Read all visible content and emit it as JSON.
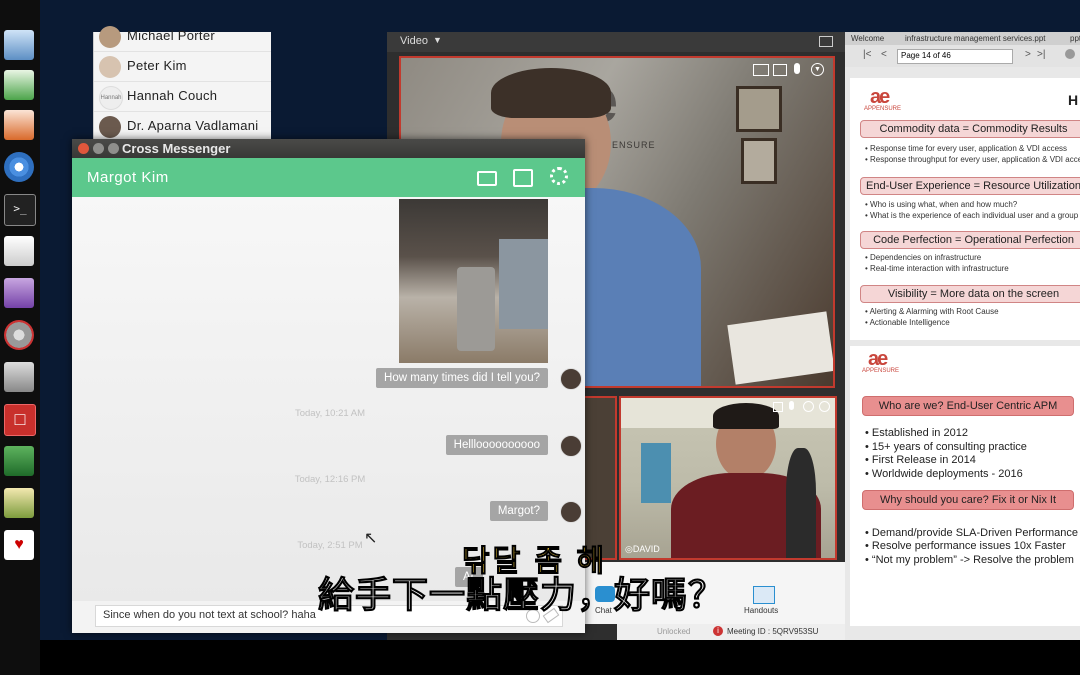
{
  "launcher": {
    "icons": [
      "image-viewer-icon",
      "spreadsheet-icon",
      "presentation-icon",
      "browser-icon",
      "terminal-icon",
      "text-editor-icon",
      "remote-desktop-icon",
      "settings-icon",
      "calculator-icon",
      "app-launcher-icon",
      "media-icon",
      "image-search-icon",
      "cards-game-icon"
    ]
  },
  "contacts": [
    {
      "name": "Michael Porter"
    },
    {
      "name": "Peter Kim"
    },
    {
      "name": "Hannah Couch",
      "avatar_text": "Hannah"
    },
    {
      "name": "Dr. Aparna Vadlamani"
    }
  ],
  "messenger": {
    "title": "Cross Messenger",
    "contact_name": "Margot Kim",
    "header_color": "#5cc88c",
    "messages": [
      {
        "text": "How many times did I tell you?"
      },
      {
        "timestamp": "Today, 10:21 AM"
      },
      {
        "text": "Hellloooooooooo"
      },
      {
        "timestamp": "Today, 12:16 PM"
      },
      {
        "text": "Margot?"
      },
      {
        "timestamp": "Today, 2:51 PM"
      },
      {
        "text": "Ar"
      }
    ],
    "composer_value": "Since when do you not text at school? haha"
  },
  "video": {
    "toolbar_label": "Video",
    "participant_name": "DAVID",
    "chat_label": "Chat",
    "handouts_label": "Handouts",
    "status": "Unlocked",
    "meeting_id": "Meeting ID : 5QRV953SU",
    "accent": "#c23a2e",
    "logo_text": "APPENSURE"
  },
  "slides": {
    "tabs": [
      "Welcome",
      "infrastructure management services.ppt",
      "ppt"
    ],
    "page_indicator": "Page 14 of 46",
    "slide1": {
      "logo": "APPENSURE",
      "heading": "H",
      "sections": [
        {
          "title": "Commodity data = Commodity Results",
          "bullets": [
            "Response time for every user, application & VDI access",
            "Response throughput for every user, application & VDI access"
          ]
        },
        {
          "title": "End-User Experience = Resource Utilization",
          "bullets": [
            "Who is using what, when and how much?",
            "What is the experience of each individual user and a group"
          ]
        },
        {
          "title": "Code Perfection = Operational Perfection",
          "bullets": [
            "Dependencies on infrastructure",
            "Real-time interaction with infrastructure"
          ]
        },
        {
          "title": "Visibility = More data on the screen",
          "bullets": [
            "Alerting & Alarming with Root Cause",
            "Actionable Intelligence"
          ]
        }
      ]
    },
    "slide2": {
      "logo": "APPENSURE",
      "sections": [
        {
          "title": "Who are we?  End-User Centric APM",
          "bullets": [
            "Established in 2012",
            "15+ years of consulting practice",
            "First Release in 2014",
            "Worldwide deployments - 2016"
          ]
        },
        {
          "title": "Why should you care? Fix it or Nix It",
          "bullets": [
            "Demand/provide SLA-Driven Performance",
            "Resolve performance issues 10x Faster",
            "“Not my problem” -> Resolve the problem"
          ]
        }
      ]
    }
  },
  "subtitles": {
    "korean": "닦달 좀 해",
    "chinese": "給手下一點壓力，好嗎？"
  }
}
